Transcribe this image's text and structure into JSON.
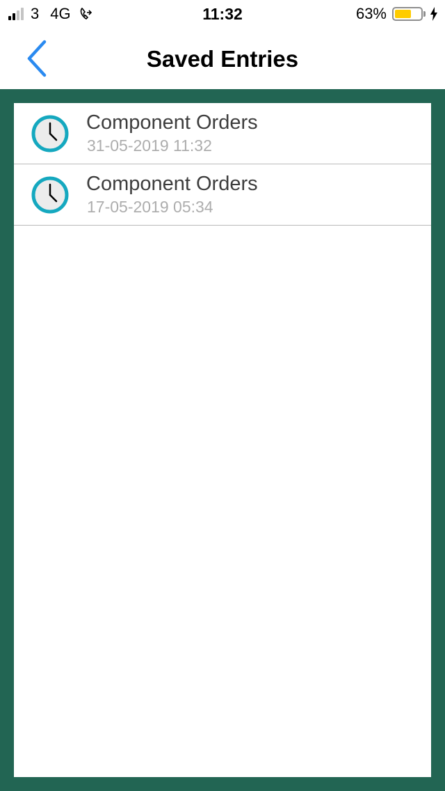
{
  "status_bar": {
    "carrier": "3",
    "network": "4G",
    "time": "11:32",
    "battery_percent": "63%",
    "battery_level": 0.63,
    "signal_bars_active": 2,
    "signal_bars_total": 4,
    "battery_color": "#ffcc00"
  },
  "nav": {
    "title": "Saved Entries",
    "back_icon": "chevron-left-icon",
    "accent_color": "#2a8af0"
  },
  "theme": {
    "background_color": "#226553",
    "clock_ring_color": "#15a8bf"
  },
  "entries": [
    {
      "title": "Component Orders",
      "date": "31-05-2019 11:32"
    },
    {
      "title": "Component Orders",
      "date": "17-05-2019 05:34"
    }
  ]
}
